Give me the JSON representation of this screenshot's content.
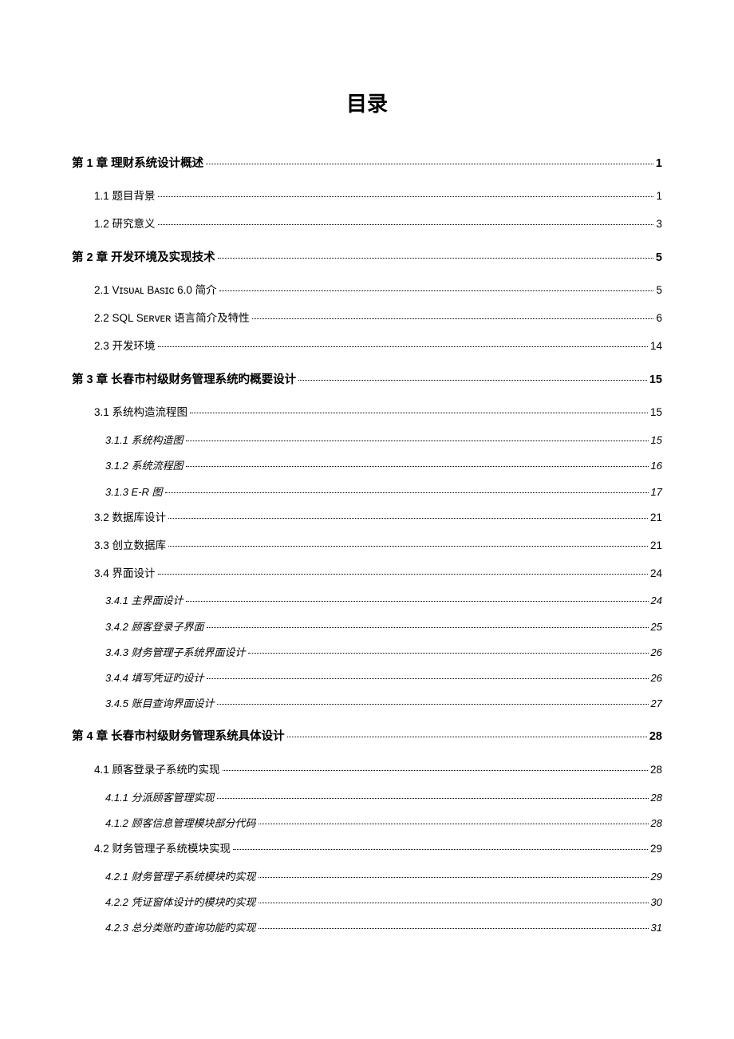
{
  "title": "目录",
  "toc": [
    {
      "level": 1,
      "label": "第 1 章   理财系统设计概述",
      "page": "1"
    },
    {
      "level": 2,
      "label": "1.1 题目背景",
      "page": "1"
    },
    {
      "level": 2,
      "label": "1.2 研究意义",
      "page": "3"
    },
    {
      "level": 1,
      "label": "第 2 章  开发环境及实现技术",
      "page": "5"
    },
    {
      "level": 2,
      "label": "2.1 Vɪsᴜᴀʟ Bᴀsɪᴄ 6.0 简介",
      "page": "5"
    },
    {
      "level": 2,
      "label": "2.2 SQL Sᴇʀᴠᴇʀ 语言简介及特性",
      "page": "6"
    },
    {
      "level": 2,
      "label": "2.3 开发环境",
      "page": "14"
    },
    {
      "level": 1,
      "label": "第 3 章  长春市村级财务管理系统旳概要设计",
      "page": "15"
    },
    {
      "level": 2,
      "label": "3.1 系统构造流程图",
      "page": "15"
    },
    {
      "level": 3,
      "label": "3.1.1 系统构造图",
      "page": "15"
    },
    {
      "level": 3,
      "label": "3.1.2 系统流程图",
      "page": "16"
    },
    {
      "level": 3,
      "label": "3.1.3 E-R 图",
      "page": "17"
    },
    {
      "level": 2,
      "label": "3.2 数据库设计",
      "page": "21"
    },
    {
      "level": 2,
      "label": "3.3 创立数据库",
      "page": "21"
    },
    {
      "level": 2,
      "label": "3.4 界面设计",
      "page": "24"
    },
    {
      "level": 3,
      "label": "3.4.1 主界面设计",
      "page": "24"
    },
    {
      "level": 3,
      "label": "3.4.2 顾客登录子界面",
      "page": "25"
    },
    {
      "level": 3,
      "label": "3.4.3 财务管理子系统界面设计",
      "page": "26"
    },
    {
      "level": 3,
      "label": "3.4.4 填写凭证旳设计",
      "page": "26"
    },
    {
      "level": 3,
      "label": "3.4.5 账目查询界面设计",
      "page": "27"
    },
    {
      "level": 1,
      "label": "第 4 章  长春市村级财务管理系统具体设计",
      "page": "28"
    },
    {
      "level": 2,
      "label": "4.1 顾客登录子系统旳实现",
      "page": "28"
    },
    {
      "level": 3,
      "label": "4.1.1 分派顾客管理实现",
      "page": "28"
    },
    {
      "level": 3,
      "label": "4.1.2 顾客信息管理模块部分代码",
      "page": "28"
    },
    {
      "level": 2,
      "label": "4.2 财务管理子系统模块实现",
      "page": "29"
    },
    {
      "level": 3,
      "label": "4.2.1  财务管理子系统模块旳实现",
      "page": "29"
    },
    {
      "level": 3,
      "label": "4.2.2  凭证窗体设计旳模块旳实现",
      "page": "30"
    },
    {
      "level": 3,
      "label": "4.2.3  总分类账旳查询功能旳实现",
      "page": "31"
    }
  ]
}
